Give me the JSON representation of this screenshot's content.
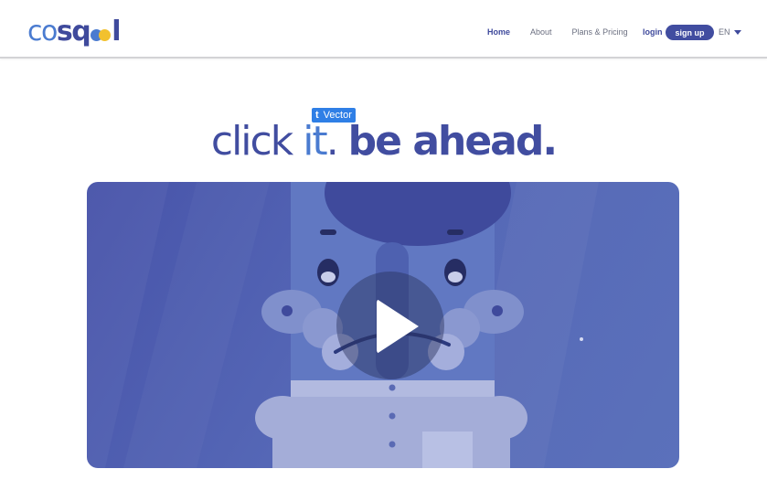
{
  "brand": {
    "logo_prefix": "co",
    "logo_middle": "sq",
    "logo_suffix": "l",
    "dot_colors": [
      "#4a7bd0",
      "#f2c12e"
    ]
  },
  "nav": {
    "items": [
      "Home",
      "About",
      "Plans & Pricing"
    ],
    "active": "Home"
  },
  "auth": {
    "login_label": "login",
    "signup_label": "sign up"
  },
  "language": {
    "current": "EN"
  },
  "hero": {
    "headline_light": "click ",
    "headline_it": "it",
    "headline_dot": ". ",
    "headline_bold": "be ahead.",
    "tag_icon": "t",
    "tag_label": "Vector"
  },
  "video": {
    "play_icon": "play-icon"
  },
  "colors": {
    "brand": "#414da0",
    "accent": "#4a7bd0",
    "tag": "#2f7fe6"
  }
}
